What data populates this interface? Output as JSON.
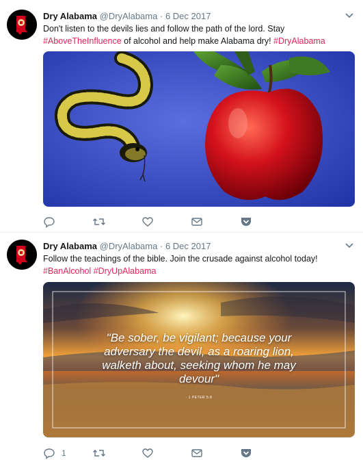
{
  "tweets": [
    {
      "display_name": "Dry Alabama",
      "handle": "@DryAlabama",
      "separator": "·",
      "timestamp": "6 Dec 2017",
      "text_parts": [
        {
          "text": "Don't listen to the devils lies and follow the path of the lord. Stay ",
          "type": "plain"
        },
        {
          "text": "#AboveTheInfluence",
          "type": "hashtag"
        },
        {
          "text": " of alcohol and help make Alabama dry! ",
          "type": "plain"
        },
        {
          "text": "#DryAlabama",
          "type": "hashtag"
        }
      ],
      "media": {
        "description_icon": "snake-and-apple-image"
      },
      "actions": {
        "reply_count": "",
        "retweet_count": "",
        "like_count": ""
      }
    },
    {
      "display_name": "Dry Alabama",
      "handle": "@DryAlabama",
      "separator": "·",
      "timestamp": "6 Dec 2017",
      "text_parts": [
        {
          "text": "Follow the teachings of the bible. Join the crusade against alcohol today!",
          "type": "plain"
        },
        {
          "text": " ",
          "type": "plain"
        },
        {
          "text": "#BanAlcohol",
          "type": "hashtag"
        },
        {
          "text": " ",
          "type": "plain"
        },
        {
          "text": "#DryUpAlabama",
          "type": "hashtag"
        }
      ],
      "media": {
        "quote_line_1": "\"Be sober, be vigilant; because your",
        "quote_line_2": "adversary the devil, as a roaring lion,",
        "quote_line_3": "walketh about, seeking whom he may",
        "quote_line_4": "devour\"",
        "citation": "- 1 PETER 5:8"
      },
      "actions": {
        "reply_count": "1",
        "retweet_count": "",
        "like_count": ""
      }
    }
  ],
  "colors": {
    "hashtag": "#e0245e",
    "meta": "#657786",
    "name": "#14171a",
    "divider": "#e6ecf0"
  }
}
